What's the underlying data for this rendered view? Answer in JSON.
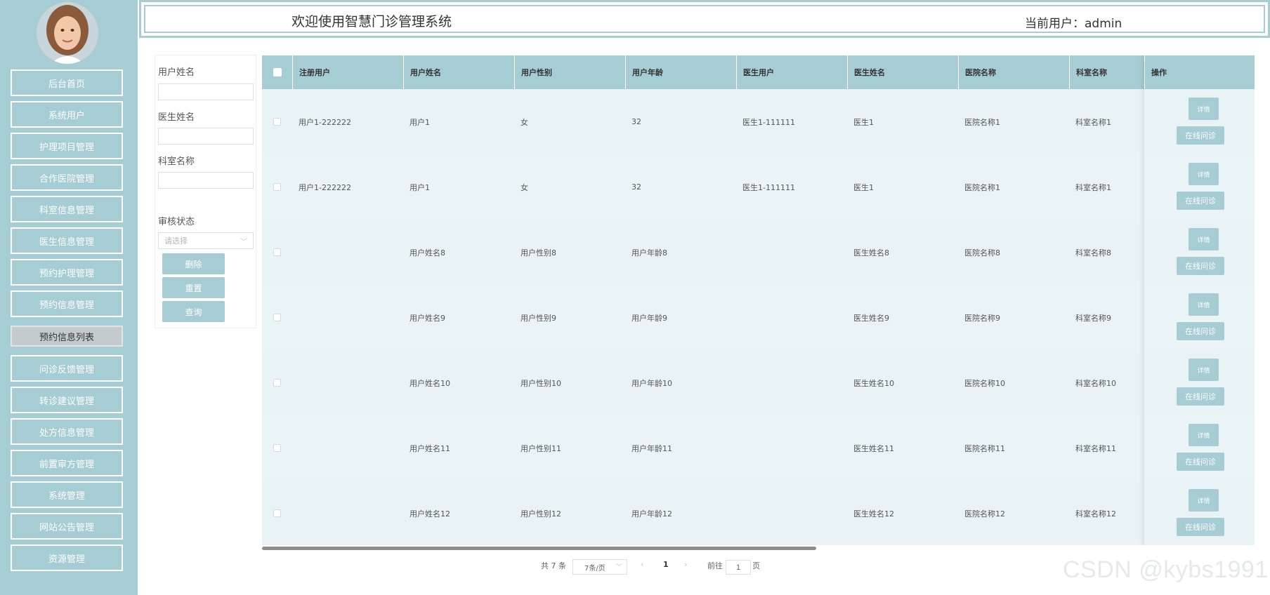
{
  "header": {
    "title": "欢迎使用智慧门诊管理系统",
    "current_user": "当前用户：admin"
  },
  "sidebar": {
    "items": [
      {
        "label": "后台首页"
      },
      {
        "label": "系统用户"
      },
      {
        "label": "护理项目管理"
      },
      {
        "label": "合作医院管理"
      },
      {
        "label": "科室信息管理"
      },
      {
        "label": "医生信息管理"
      },
      {
        "label": "预约护理管理"
      },
      {
        "label": "预约信息管理"
      },
      {
        "label": "预约信息列表"
      },
      {
        "label": "问诊反馈管理"
      },
      {
        "label": "转诊建议管理"
      },
      {
        "label": "处方信息管理"
      },
      {
        "label": "前置审方管理"
      },
      {
        "label": "系统管理"
      },
      {
        "label": "网站公告管理"
      },
      {
        "label": "资源管理"
      }
    ]
  },
  "search": {
    "user_name_label": "用户姓名",
    "doctor_name_label": "医生姓名",
    "department_label": "科室名称",
    "status_label": "审核状态",
    "status_placeholder": "请选择",
    "delete_label": "删除",
    "reset_label": "重置",
    "query_label": "查询"
  },
  "table": {
    "columns": [
      "注册用户",
      "用户姓名",
      "用户性别",
      "用户年龄",
      "医生用户",
      "医生姓名",
      "医院名称",
      "科室名称",
      "操作"
    ],
    "rows": [
      {
        "reg_user": "用户1-222222",
        "user_name": "用户1",
        "gender": "女",
        "age": "32",
        "doctor_user": "医生1-111111",
        "doctor_name": "医生1",
        "hospital": "医院名称1",
        "department": "科室名称1"
      },
      {
        "reg_user": "用户1-222222",
        "user_name": "用户1",
        "gender": "女",
        "age": "32",
        "doctor_user": "医生1-111111",
        "doctor_name": "医生1",
        "hospital": "医院名称1",
        "department": "科室名称1"
      },
      {
        "reg_user": "",
        "user_name": "用户姓名8",
        "gender": "用户性别8",
        "age": "用户年龄8",
        "doctor_user": "",
        "doctor_name": "医生姓名8",
        "hospital": "医院名称8",
        "department": "科室名称8"
      },
      {
        "reg_user": "",
        "user_name": "用户姓名9",
        "gender": "用户性别9",
        "age": "用户年龄9",
        "doctor_user": "",
        "doctor_name": "医生姓名9",
        "hospital": "医院名称9",
        "department": "科室名称9"
      },
      {
        "reg_user": "",
        "user_name": "用户姓名10",
        "gender": "用户性别10",
        "age": "用户年龄10",
        "doctor_user": "",
        "doctor_name": "医生姓名10",
        "hospital": "医院名称10",
        "department": "科室名称10"
      },
      {
        "reg_user": "",
        "user_name": "用户姓名11",
        "gender": "用户性别11",
        "age": "用户年龄11",
        "doctor_user": "",
        "doctor_name": "医生姓名11",
        "hospital": "医院名称11",
        "department": "科室名称11"
      },
      {
        "reg_user": "",
        "user_name": "用户姓名12",
        "gender": "用户性别12",
        "age": "用户年龄12",
        "doctor_user": "",
        "doctor_name": "医生姓名12",
        "hospital": "医院名称12",
        "department": "科室名称12"
      }
    ],
    "detail_label": "详情",
    "consult_label": "在线问诊"
  },
  "pagination": {
    "total": "共 7 条",
    "page_size": "7条/页",
    "current_page": "1",
    "goto_prefix": "前往",
    "goto_value": "1",
    "goto_suffix": "页"
  },
  "watermark": "CSDN @kybs1991",
  "colors": {
    "accent": "#a5cdd3",
    "row_bg": "#e9f2f4"
  }
}
